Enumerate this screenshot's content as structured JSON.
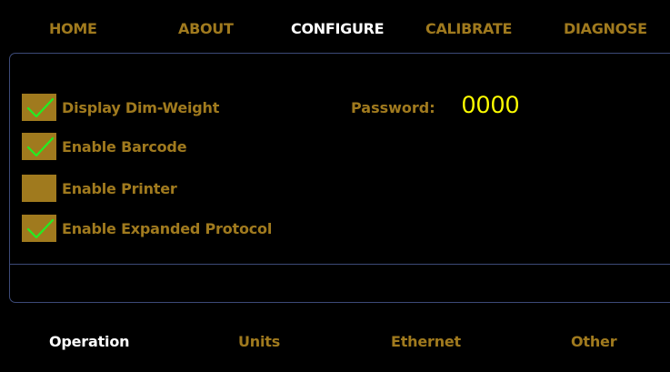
{
  "topnav": {
    "items": [
      {
        "label": "HOME",
        "active": false
      },
      {
        "label": "ABOUT",
        "active": false
      },
      {
        "label": "CONFIGURE",
        "active": true
      },
      {
        "label": "CALIBRATE",
        "active": false
      },
      {
        "label": "DIAGNOSE",
        "active": false
      }
    ]
  },
  "options": [
    {
      "label": "Display Dim-Weight",
      "checked": true
    },
    {
      "label": "Enable Barcode",
      "checked": true
    },
    {
      "label": "Enable Printer",
      "checked": false
    },
    {
      "label": "Enable Expanded Protocol",
      "checked": true
    }
  ],
  "password": {
    "label": "Password:",
    "value": "0000"
  },
  "bottomtabs": {
    "items": [
      {
        "label": "Operation",
        "active": true
      },
      {
        "label": "Units",
        "active": false
      },
      {
        "label": "Ethernet",
        "active": false
      },
      {
        "label": "Other",
        "active": false
      }
    ]
  },
  "colors": {
    "accent": "#a07a1e",
    "active_text": "#ffffff",
    "checkmark": "#22ee22",
    "password_value": "#ffff00",
    "panel_border": "#3c4a78",
    "background": "#000000"
  },
  "icons": {
    "check": "checkmark-icon"
  }
}
